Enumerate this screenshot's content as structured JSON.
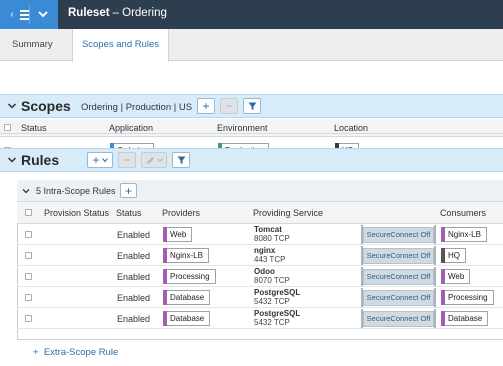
{
  "header": {
    "title_bold": "Ruleset",
    "title_rest": "– Ordering"
  },
  "tabs": [
    {
      "label": "Summary",
      "active": false
    },
    {
      "label": "Scopes and Rules",
      "active": true
    }
  ],
  "scopes": {
    "title": "Scopes",
    "crumb": "Ordering | Production | US",
    "columns": [
      "Status",
      "Application",
      "Environment",
      "Location"
    ],
    "row": {
      "application": "Ordering",
      "environment": "Production",
      "location": "US"
    }
  },
  "rules": {
    "title": "Rules",
    "intra_label": "5 Intra-Scope Rules",
    "columns": [
      "Provision Status",
      "Status",
      "Providers",
      "Providing Service",
      "Consumers"
    ],
    "rows": [
      {
        "status": "Enabled",
        "provider": "Web",
        "service": "Tomcat",
        "port": "8080 TCP",
        "secure": "SecureConnect Off",
        "consumer": "Nginx-LB"
      },
      {
        "status": "Enabled",
        "provider": "Nginx-LB",
        "service": "nginx",
        "port": "443 TCP",
        "secure": "SecureConnect Off",
        "consumer": "HQ"
      },
      {
        "status": "Enabled",
        "provider": "Processing",
        "service": "Odoo",
        "port": "8070 TCP",
        "secure": "SecureConnect Off",
        "consumer": "Web"
      },
      {
        "status": "Enabled",
        "provider": "Database",
        "service": "PostgreSQL",
        "port": "5432 TCP",
        "secure": "SecureConnect Off",
        "consumer": "Processing"
      },
      {
        "status": "Enabled",
        "provider": "Database",
        "service": "PostgreSQL",
        "port": "5432 TCP",
        "secure": "SecureConnect Off",
        "consumer": "Database"
      }
    ],
    "extra_label": "Extra-Scope Rule"
  },
  "colors": {
    "app_tag": "#3a8ad6",
    "env_tag": "#2fa37a",
    "loc_tag": "#2d3e4f",
    "role_tag": "#a05fb4",
    "hq_tag": "#555555"
  }
}
